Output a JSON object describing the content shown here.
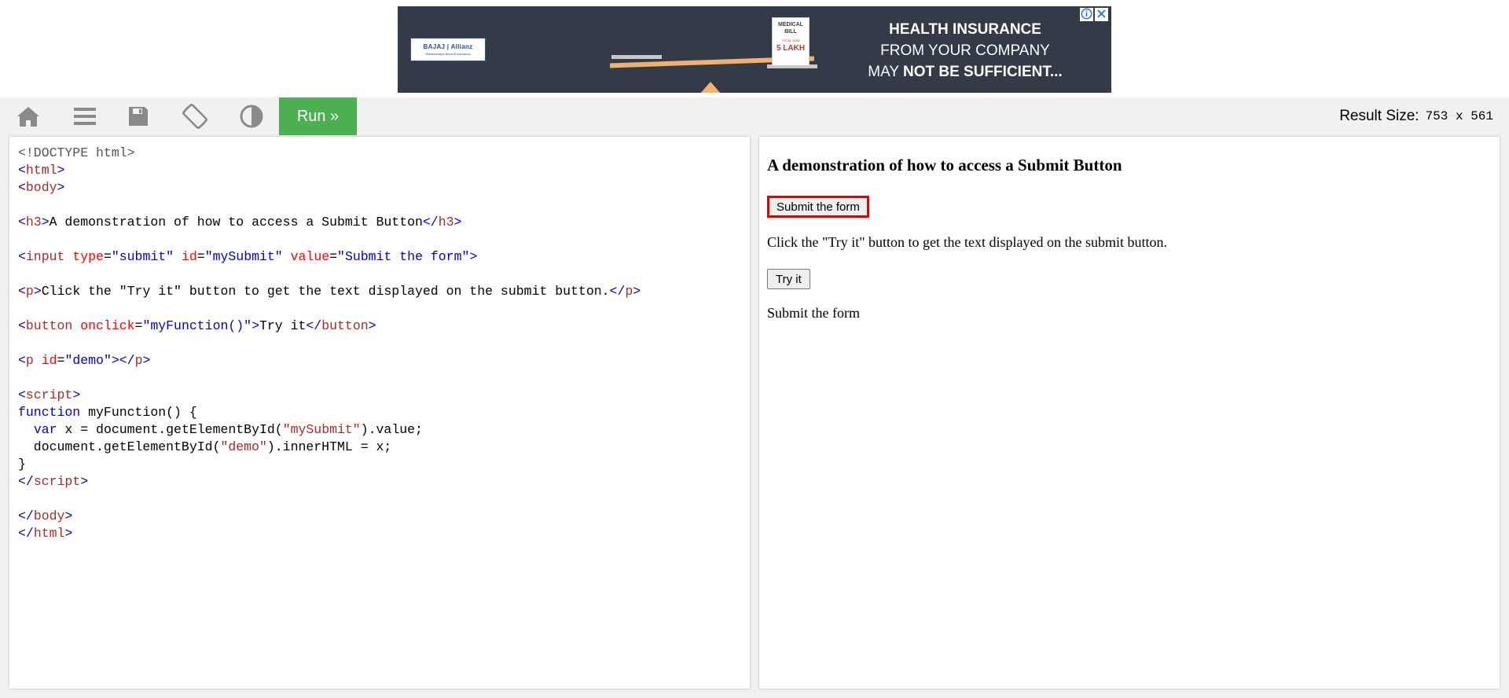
{
  "ad": {
    "logo_text": "BAJAJ | Allianz",
    "logo_tagline": "Relationships Beyond Insurance",
    "bill_title": "MEDICAL BILL",
    "bill_small": "TOTAL SUM",
    "bill_amount": "5 LAKH",
    "line1": "HEALTH INSURANCE",
    "line2": "FROM YOUR COMPANY",
    "line3_prefix": "MAY ",
    "line3_bold": "NOT BE SUFFICIENT...",
    "info_icon": "info-icon",
    "close_icon": "close-icon"
  },
  "toolbar": {
    "icons": [
      "home-icon",
      "menu-icon",
      "save-icon",
      "rotate-icon",
      "contrast-icon"
    ],
    "run_label": "Run »",
    "result_size_label": "Result Size:",
    "result_size_value": "753 x 561"
  },
  "result": {
    "heading": "A demonstration of how to access a Submit Button",
    "submit_label": "Submit the form",
    "paragraph": "Click the \"Try it\" button to get the text displayed on the submit button.",
    "try_label": "Try it",
    "demo_text": "Submit the form"
  },
  "colors": {
    "run_green": "#4caf50",
    "toolbar_bg": "#f1f1f1",
    "ad_bg": "#333b48",
    "highlight_border": "#e00000"
  }
}
